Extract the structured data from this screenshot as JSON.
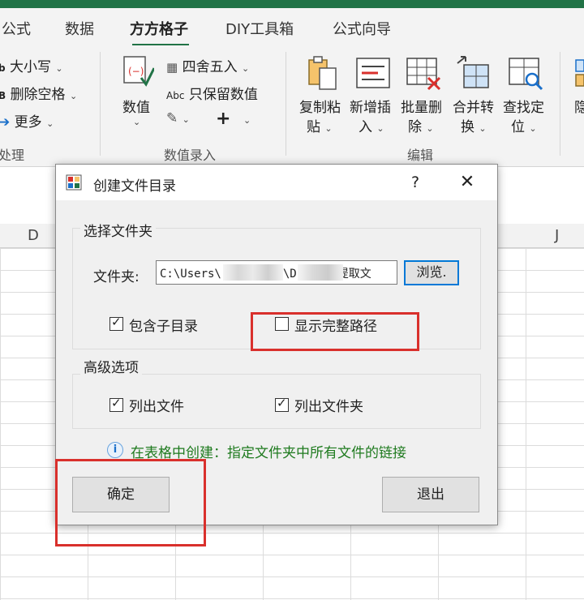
{
  "ribbon": {
    "tabs": [
      "公式",
      "数据",
      "方方格子",
      "DIY工具箱",
      "公式向导"
    ],
    "active_tab": "方方格子",
    "text_group": {
      "case_label": "大小写",
      "delete_space_label": "删除空格",
      "more_label": "更多",
      "group_label": "处理"
    },
    "number_group": {
      "number_label": "数值",
      "round_label": "四舍五入",
      "keep_value_label": "只保留数值",
      "abc_prefix": "Abc",
      "group_label": "数值录入"
    },
    "edit_group": {
      "copy_paste_top": "复制粘",
      "copy_paste_bottom": "贴",
      "insert_top": "新增插",
      "insert_bottom": "入",
      "batch_delete_top": "批量删",
      "batch_delete_bottom": "除",
      "merge_top": "合并转",
      "merge_bottom": "换",
      "locate_top": "查找定",
      "locate_bottom": "位",
      "partial_top": "隐",
      "group_label": "编辑"
    }
  },
  "sheet": {
    "columns": [
      "D",
      "J"
    ]
  },
  "dialog": {
    "title": "创建文件目录",
    "help": "?",
    "close": "✕",
    "folder_group_title": "选择文件夹",
    "folder_label": "文件夹:",
    "path_start": "C:\\Users\\",
    "path_mid": "\\D",
    "path_end": "提取文",
    "browse_label": "浏览.",
    "include_subdirs_label": "包含子目录",
    "include_subdirs_checked": true,
    "show_full_path_label": "显示完整路径",
    "show_full_path_checked": false,
    "advanced_group_title": "高级选项",
    "list_files_label": "列出文件",
    "list_files_checked": true,
    "list_folders_label": "列出文件夹",
    "list_folders_checked": true,
    "info_text": "在表格中创建：指定文件夹中所有文件的链接",
    "ok_label": "确定",
    "exit_label": "退出"
  },
  "colors": {
    "excel_green": "#217346",
    "annotation_red": "#d9302c",
    "info_green": "#1e7a1e",
    "focus_blue": "#0078d7"
  }
}
